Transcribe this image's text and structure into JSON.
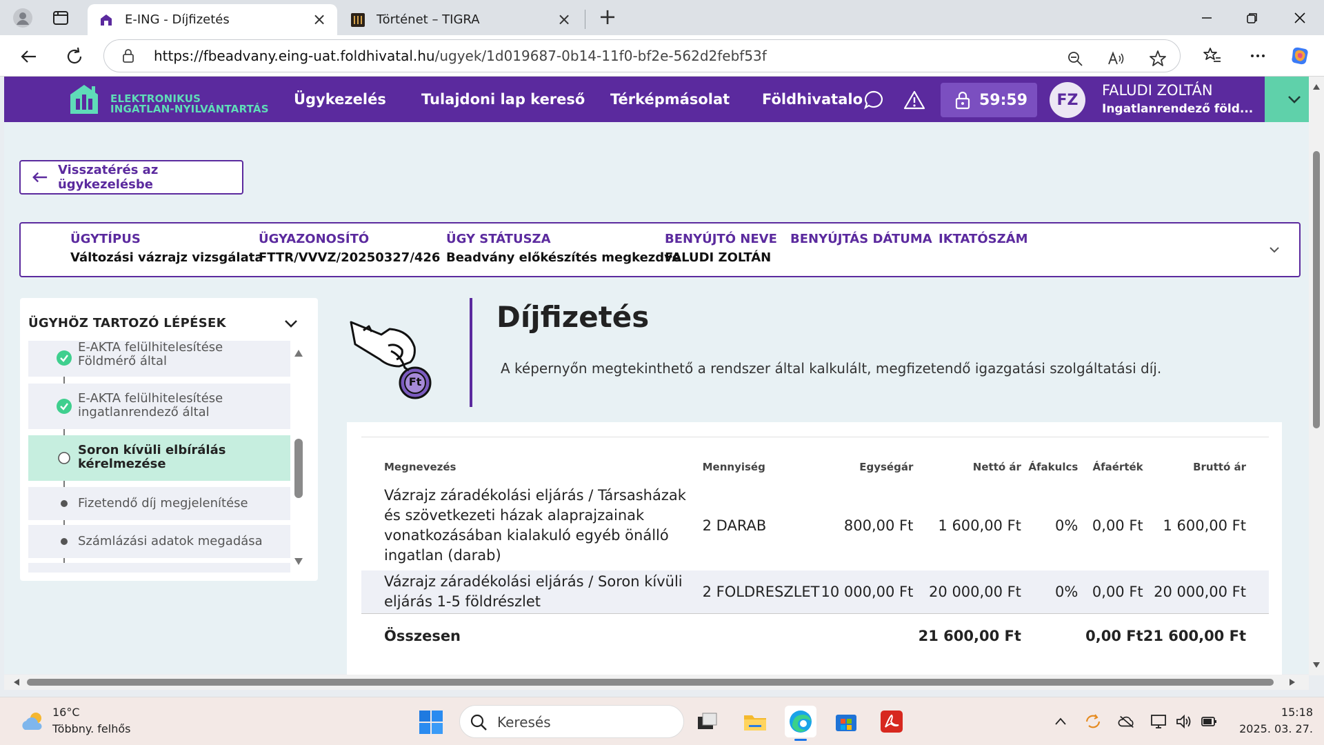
{
  "browser": {
    "tabs": [
      {
        "title": "E-ING - Díjfizetés",
        "active": true
      },
      {
        "title": "Történet – TIGRA",
        "active": false
      }
    ],
    "url_host": "https://fbeadvany.eing-uat.foldhivatal.hu",
    "url_path": "/ugyek/1d019687-0b14-11f0-bf2e-562d2febf53f"
  },
  "header": {
    "logo_line1": "ELEKTRONIKUS",
    "logo_line2": "INGATLAN-NYILVÁNTARTÁS",
    "nav": [
      "Ügykezelés",
      "Tulajdoni lap kereső",
      "Térképmásolat",
      "Földhivatalo"
    ],
    "timer": "59:59",
    "avatar_initials": "FZ",
    "user_name": "FALUDI ZOLTÁN",
    "user_org": "Ingatlanrendező föld...",
    "accent": "#5b2a9e",
    "mint": "#5fd1aa"
  },
  "back_button": "Visszatérés az ügykezelésbe",
  "case": {
    "type_label": "ÜGYTÍPUS",
    "type_value": "Változási vázrajz vizsgálata",
    "id_label": "ÜGYAZONOSÍTÓ",
    "id_value": "FTTR/VVVZ/20250327/426",
    "status_label": "ÜGY STÁTUSZA",
    "status_value": "Beadvány előkészítés megkezdve",
    "submitter_label": "BENYÚJTÓ NEVE",
    "submitter_value": "FALUDI ZOLTÁN",
    "date_label": "BENYÚJTÁS DÁTUMA",
    "filing_label": "IKTATÓSZÁM"
  },
  "steps": {
    "title": "ÜGYHÖZ TARTOZÓ LÉPÉSEK",
    "items": [
      {
        "line1": "E-AKTA felülhitelesítése",
        "line2": "Földmérő által",
        "state": "done"
      },
      {
        "line1": "E-AKTA felülhitelesítése",
        "line2": "ingatlanrendező által",
        "state": "done"
      },
      {
        "line1": "Soron kívüli elbírálás",
        "line2": "kérelmezése",
        "state": "current"
      },
      {
        "line1": "Fizetendő díj megjelenítése",
        "line2": "",
        "state": "pending"
      },
      {
        "line1": "Számlázási adatok megadása",
        "line2": "",
        "state": "pending"
      }
    ]
  },
  "page": {
    "title": "Díjfizetés",
    "subtitle": "A képernyőn megtekinthető a rendszer által kalkulált, megfizetendő igazgatási szolgáltatási díj.",
    "coin_label": "Ft"
  },
  "fees": {
    "headers": [
      "Megnevezés",
      "Mennyiség",
      "Egységár",
      "Nettó ár",
      "Áfakulcs",
      "Áfaérték",
      "Bruttó ár"
    ],
    "rows": [
      {
        "name": "Vázrajz záradékolási eljárás / Társasházak és szövetkezeti házak alaprajzainak vonatkozásában kialakuló egyéb önálló ingatlan (darab)",
        "qty": "2 DARAB",
        "unit": "800,00 Ft",
        "net": "1 600,00 Ft",
        "vat_rate": "0%",
        "vat": "0,00 Ft",
        "gross": "1 600,00 Ft"
      },
      {
        "name": "Vázrajz záradékolási eljárás / Soron kívüli eljárás 1-5 földrészlet",
        "qty": "2 FOLDRESZLET",
        "unit": "10 000,00 Ft",
        "net": "20 000,00 Ft",
        "vat_rate": "0%",
        "vat": "0,00 Ft",
        "gross": "20 000,00 Ft"
      }
    ],
    "total_label": "Összesen",
    "total_net": "21 600,00 Ft",
    "total_vat": "0,00 Ft",
    "total_gross": "21 600,00 Ft"
  },
  "taskbar": {
    "temp": "16°C",
    "weather": "Többny. felhős",
    "search_placeholder": "Keresés",
    "time": "15:18",
    "date": "2025. 03. 27."
  }
}
